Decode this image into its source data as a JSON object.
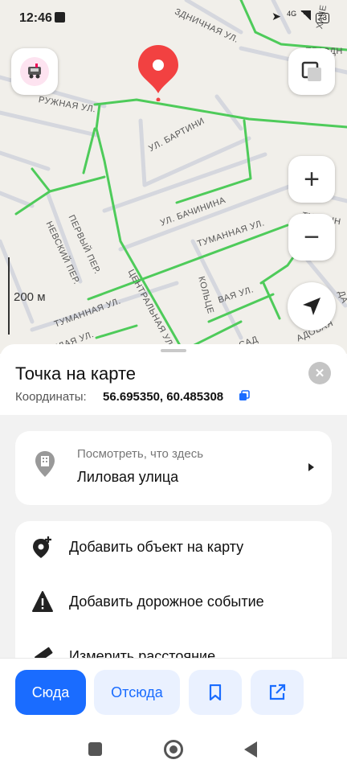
{
  "status_bar": {
    "time": "12:46",
    "network": "4G",
    "battery": "73"
  },
  "map": {
    "streets": [
      "ЗДНИЧНАЯ УЛ.",
      "ХАЧЕ",
      "ПРАЗДН",
      "РУЖНАЯ УЛ.",
      "УЛ. БАРТИНИ",
      "УЛ. БАЧИНИНА",
      "ПЕРВЫЙ ПЕР.",
      "НЕВСКИЙ ПЕР.",
      "ТУМАННАЯ УЛ.",
      "ТУМАНН",
      "ЦЕНТРАЛЬНАЯ УЛ.",
      "КОЛЬЦЕ",
      "ВАЯ УЛ.",
      "ТУМАННАЯ УЛ.",
      "ЕЛАЯ УЛ.",
      "САД",
      "АДОВАЯ",
      "ДА"
    ],
    "scale_label": "200 м",
    "zoom_in": "+",
    "zoom_out": "−"
  },
  "sheet": {
    "title": "Точка на карте",
    "coords_label": "Координаты:",
    "coords_value": "56.695350, 60.485308",
    "close": "✕",
    "whats_here_hint": "Посмотреть, что здесь",
    "whats_here_place": "Лиловая улица",
    "actions": [
      "Добавить объект на карту",
      "Добавить дорожное событие",
      "Измерить расстояние"
    ]
  },
  "bottom": {
    "here": "Сюда",
    "from": "Отсюда"
  },
  "colors": {
    "accent": "#1a6cff",
    "pin": "#f24141",
    "road_green": "#4ecb5a"
  }
}
